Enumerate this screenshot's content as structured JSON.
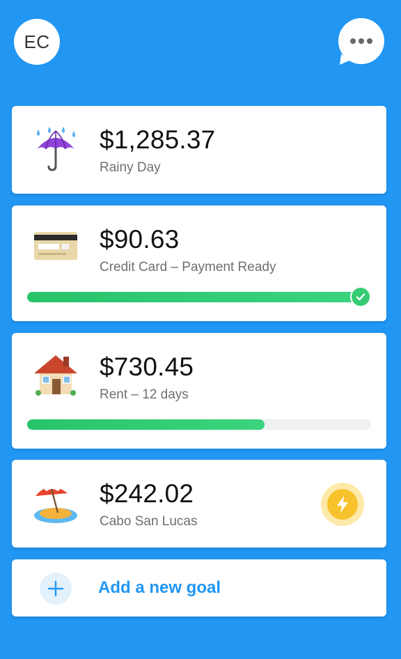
{
  "header": {
    "avatar_initials": "EC",
    "menu_icon": "chat-more-icon"
  },
  "colors": {
    "background": "#2196F3",
    "progress_green": "#35cc74",
    "accent_blue": "#2196F3",
    "bolt_yellow": "#f8c22c"
  },
  "goals": [
    {
      "icon": "umbrella-rain-icon",
      "amount": "$1,285.37",
      "label": "Rainy Day"
    },
    {
      "icon": "credit-card-icon",
      "amount": "$90.63",
      "label": "Credit Card – Payment Ready",
      "progress": 1.0,
      "complete": true
    },
    {
      "icon": "house-icon",
      "amount": "$730.45",
      "label": "Rent – 12 days",
      "progress": 0.69
    },
    {
      "icon": "beach-island-icon",
      "amount": "$242.02",
      "label": "Cabo San Lucas",
      "boost_icon": "lightning-bolt-icon"
    }
  ],
  "add_goal": {
    "label": "Add a new goal",
    "icon": "plus-icon"
  }
}
